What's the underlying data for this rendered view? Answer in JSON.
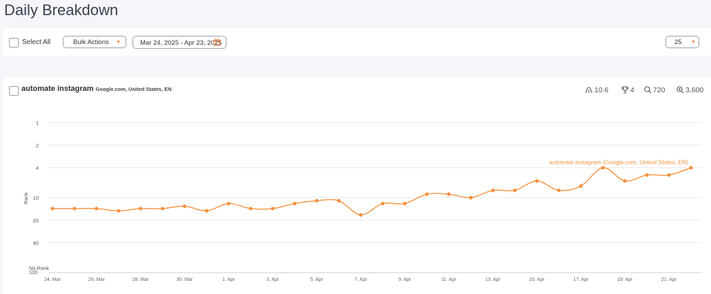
{
  "page": {
    "title": "Daily Breakdown"
  },
  "toolbar": {
    "select_all": "Select All",
    "bulk_actions": "Bulk Actions",
    "date_range": "Mar 24, 2025 - Apr 23, 2025",
    "per_page": "25"
  },
  "keyword": {
    "name": "automate instagram",
    "location": "Google.com, United States, EN",
    "stats": {
      "avg_position": "10.6",
      "best_position": "4",
      "search_volume": "720",
      "results": "3,600"
    }
  },
  "colors": {
    "accent": "#f5913e",
    "grid": "#e8e8e8"
  },
  "chart_data": {
    "type": "line",
    "title": "",
    "ylabel": "Rank",
    "y_axis": {
      "scale": "log",
      "inverted": true,
      "ticks": [
        "1",
        "2",
        "4",
        "10",
        "20",
        "40",
        "No Rank"
      ],
      "tick_values": [
        1,
        2,
        4,
        10,
        20,
        40,
        100
      ]
    },
    "x_tick_labels": [
      "24. Mar",
      "26. Mar",
      "28. Mar",
      "30. Mar",
      "1. Apr",
      "3. Apr",
      "5. Apr",
      "7. Apr",
      "9. Apr",
      "11. Apr",
      "13. Apr",
      "15. Apr",
      "17. Apr",
      "19. Apr",
      "21. Apr"
    ],
    "x": [
      "Mar 24",
      "Mar 25",
      "Mar 26",
      "Mar 27",
      "Mar 28",
      "Mar 29",
      "Mar 30",
      "Mar 31",
      "Apr 1",
      "Apr 2",
      "Apr 3",
      "Apr 4",
      "Apr 5",
      "Apr 6",
      "Apr 7",
      "Apr 8",
      "Apr 9",
      "Apr 10",
      "Apr 11",
      "Apr 12",
      "Apr 13",
      "Apr 14",
      "Apr 15",
      "Apr 16",
      "Apr 17",
      "Apr 18",
      "Apr 19",
      "Apr 20",
      "Apr 21",
      "Apr 22"
    ],
    "series": [
      {
        "name": "automate instagram (Google.com, United States, EN)",
        "values": [
          14,
          14,
          14,
          15,
          14,
          14,
          13,
          15,
          12,
          14,
          14,
          12,
          11,
          11,
          17,
          12,
          12,
          9,
          9,
          10,
          8,
          8,
          6,
          8,
          7,
          4,
          6,
          5,
          5,
          4
        ]
      }
    ],
    "grid": true,
    "legend": "none"
  }
}
